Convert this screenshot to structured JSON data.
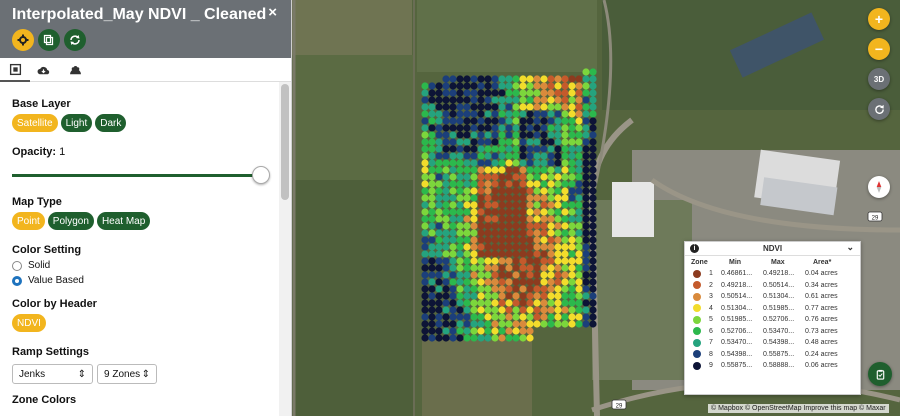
{
  "panel": {
    "title": "Interpolated_May NDVI _ Cleaned",
    "close_label": "×",
    "buttons": [
      "settings-icon",
      "copy-icon",
      "sync-icon"
    ],
    "tabs": [
      "layer-settings-icon",
      "cloud-download-icon",
      "users-icon"
    ]
  },
  "base_layer": {
    "label": "Base Layer",
    "options": [
      "Satellite",
      "Light",
      "Dark"
    ],
    "selected": "Satellite"
  },
  "opacity": {
    "label": "Opacity:",
    "value": "1",
    "level": 1
  },
  "map_type": {
    "label": "Map Type",
    "options": [
      "Point",
      "Polygon",
      "Heat Map"
    ],
    "selected": "Point"
  },
  "color_setting": {
    "label": "Color Setting",
    "options": [
      "Solid",
      "Value Based"
    ],
    "selected": "Value Based"
  },
  "color_by_header": {
    "label": "Color by Header",
    "options": [
      "NDVI"
    ],
    "selected": "NDVI"
  },
  "ramp_settings": {
    "label": "Ramp Settings",
    "method": "Jenks",
    "zones": "9 Zones"
  },
  "zone_colors": {
    "label": "Zone Colors"
  },
  "map_controls": {
    "zoom_in": "+",
    "zoom_out": "−",
    "view_3d": "3D"
  },
  "legend": {
    "title": "NDVI",
    "info": "i",
    "headers": [
      "Zone",
      "Min",
      "Max",
      "Area*"
    ],
    "rows": [
      {
        "zone": "1",
        "min": "0.46861...",
        "max": "0.49218...",
        "area": "0.04 acres",
        "color": "#8c3b1f"
      },
      {
        "zone": "2",
        "min": "0.49218...",
        "max": "0.50514...",
        "area": "0.34 acres",
        "color": "#c45a2c"
      },
      {
        "zone": "3",
        "min": "0.50514...",
        "max": "0.51304...",
        "area": "0.61 acres",
        "color": "#d98a3c"
      },
      {
        "zone": "4",
        "min": "0.51304...",
        "max": "0.51985...",
        "area": "0.77 acres",
        "color": "#f2dc2c"
      },
      {
        "zone": "5",
        "min": "0.51985...",
        "max": "0.52706...",
        "area": "0.76 acres",
        "color": "#7cd63c"
      },
      {
        "zone": "6",
        "min": "0.52706...",
        "max": "0.53470...",
        "area": "0.73 acres",
        "color": "#2cb84c"
      },
      {
        "zone": "7",
        "min": "0.53470...",
        "max": "0.54398...",
        "area": "0.48 acres",
        "color": "#25a37e"
      },
      {
        "zone": "8",
        "min": "0.54398...",
        "max": "0.55875...",
        "area": "0.24 acres",
        "color": "#1c3f7a"
      },
      {
        "zone": "9",
        "min": "0.55875...",
        "max": "0.58888...",
        "area": "0.06 acres",
        "color": "#0d1436"
      }
    ]
  },
  "attribution": "© Mapbox © OpenStreetMap Improve this map © Maxar",
  "road_label": "29",
  "colors": {
    "accent": "#f2b51e",
    "brand": "#1f5f2e",
    "header": "#6b7075"
  }
}
